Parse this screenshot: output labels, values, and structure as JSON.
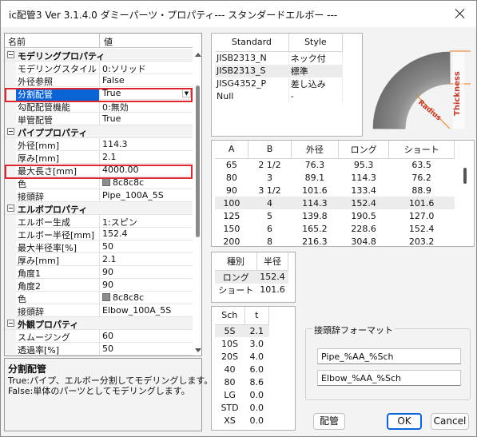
{
  "window": {
    "title": "ic配管3 Ver 3.1.4.0 ダミーパーツ・プロパティ--- スタンダードエルボー ---"
  },
  "grid": {
    "header_name": "名前",
    "header_value": "値",
    "rows": [
      {
        "type": "cat",
        "name": "モデリングプロパティ"
      },
      {
        "type": "prop",
        "name": "モデリングスタイル",
        "value": "0:ソリッド"
      },
      {
        "type": "prop",
        "name": "外径参照",
        "value": "False"
      },
      {
        "type": "prop",
        "name": "分割配管",
        "value": "True",
        "selected": true
      },
      {
        "type": "prop",
        "name": "勾配配管機能",
        "value": "0:無効"
      },
      {
        "type": "prop",
        "name": "単管配管",
        "value": "True"
      },
      {
        "type": "cat",
        "name": "パイププロパティ"
      },
      {
        "type": "prop",
        "name": "外径[mm]",
        "value": "114.3"
      },
      {
        "type": "prop",
        "name": "厚み[mm]",
        "value": "2.1"
      },
      {
        "type": "prop",
        "name": "最大長さ[mm]",
        "value": "4000.00"
      },
      {
        "type": "prop",
        "name": "色",
        "value": "8c8c8c",
        "swatch": "#8c8c8c"
      },
      {
        "type": "prop",
        "name": "接頭辞",
        "value": "Pipe_100A_5S"
      },
      {
        "type": "cat",
        "name": "エルボプロパティ"
      },
      {
        "type": "prop",
        "name": "エルボー生成",
        "value": "1:スピン"
      },
      {
        "type": "prop",
        "name": "エルボー半径[mm]",
        "value": "152.4"
      },
      {
        "type": "prop",
        "name": "最大半径率[%]",
        "value": "50"
      },
      {
        "type": "prop",
        "name": "厚み[mm]",
        "value": "2.1"
      },
      {
        "type": "prop",
        "name": "角度1",
        "value": "90"
      },
      {
        "type": "prop",
        "name": "角度2",
        "value": "90"
      },
      {
        "type": "prop",
        "name": "色",
        "value": "8c8c8c",
        "swatch": "#8c8c8c"
      },
      {
        "type": "prop",
        "name": "接頭辞",
        "value": "Elbow_100A_5S"
      },
      {
        "type": "cat",
        "name": "外観プロパティ"
      },
      {
        "type": "prop",
        "name": "スムージング",
        "value": "60"
      },
      {
        "type": "prop",
        "name": "透過率[%]",
        "value": "50"
      }
    ]
  },
  "description": {
    "title": "分割配管",
    "line1": "True:パイプ、エルボー分割してモデリングします。",
    "line2": "False:単体のパーツとしてモデリングします。"
  },
  "standards": {
    "headers": [
      "Standard",
      "Style"
    ],
    "rows": [
      [
        "JISB2313_N",
        "ネック付"
      ],
      [
        "JISB2313_S",
        "標準"
      ],
      [
        "JISG4352_P",
        "差し込み"
      ],
      [
        "Null",
        "-"
      ]
    ],
    "selected_index": 1
  },
  "dimensions": {
    "headers": [
      "A",
      "B",
      "外径",
      "ロング",
      "ショート"
    ],
    "rows": [
      [
        "65",
        "2 1/2",
        "76.3",
        "95.3",
        "63.5"
      ],
      [
        "80",
        "3",
        "89.1",
        "114.3",
        "76.2"
      ],
      [
        "90",
        "3 1/2",
        "101.6",
        "133.4",
        "88.9"
      ],
      [
        "100",
        "4",
        "114.3",
        "152.4",
        "101.6"
      ],
      [
        "125",
        "5",
        "139.8",
        "190.5",
        "127.0"
      ],
      [
        "150",
        "6",
        "165.2",
        "228.6",
        "152.4"
      ],
      [
        "200",
        "8",
        "216.3",
        "304.8",
        "203.2"
      ]
    ],
    "selected_index": 3
  },
  "lengths": {
    "headers": [
      "種別",
      "半径"
    ],
    "rows": [
      [
        "ロング",
        "152.4"
      ],
      [
        "ショート",
        "101.6"
      ]
    ],
    "selected_index": 0
  },
  "schedule": {
    "headers": [
      "Sch",
      "t"
    ],
    "rows": [
      [
        "5S",
        "2.1"
      ],
      [
        "10S",
        "3.0"
      ],
      [
        "20S",
        "4.0"
      ],
      [
        "40",
        "6.0"
      ],
      [
        "80",
        "8.6"
      ],
      [
        "LG",
        "0.0"
      ],
      [
        "STD",
        "0.0"
      ],
      [
        "XS",
        "0.0"
      ]
    ],
    "selected_index": 0
  },
  "prefix_format": {
    "label": "接頭辞フォーマット",
    "pipe": "Pipe_%AA_%Sch",
    "elbow": "Elbow_%AA_%Sch"
  },
  "illustration": {
    "thickness_label": "Thickness",
    "radius_label": "Radius"
  },
  "buttons": {
    "piping": "配管",
    "ok": "OK",
    "cancel": "Cancel"
  },
  "colors": {
    "selection": "#0a64d6",
    "highlight_frame": "#e0262e",
    "elbow": "#8c8c8c"
  }
}
